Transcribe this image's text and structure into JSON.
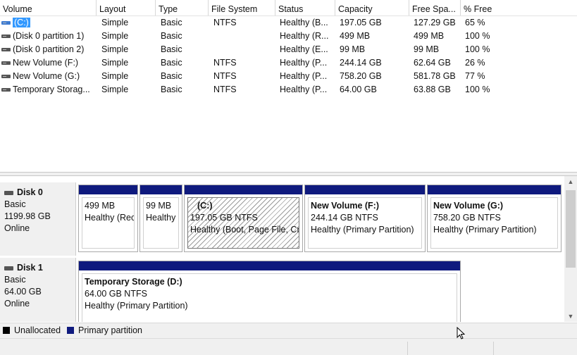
{
  "volume_table": {
    "columns": [
      "Volume",
      "Layout",
      "Type",
      "File System",
      "Status",
      "Capacity",
      "Free Spa...",
      "% Free"
    ],
    "rows": [
      {
        "volume": "(C:)",
        "layout": "Simple",
        "type": "Basic",
        "fs": "NTFS",
        "status": "Healthy (B...",
        "capacity": "197.05 GB",
        "free": "127.29 GB",
        "pct": "65 %"
      },
      {
        "volume": "(Disk 0 partition 1)",
        "layout": "Simple",
        "type": "Basic",
        "fs": "",
        "status": "Healthy (R...",
        "capacity": "499 MB",
        "free": "499 MB",
        "pct": "100 %"
      },
      {
        "volume": "(Disk 0 partition 2)",
        "layout": "Simple",
        "type": "Basic",
        "fs": "",
        "status": "Healthy (E...",
        "capacity": "99 MB",
        "free": "99 MB",
        "pct": "100 %"
      },
      {
        "volume": "New Volume (F:)",
        "layout": "Simple",
        "type": "Basic",
        "fs": "NTFS",
        "status": "Healthy (P...",
        "capacity": "244.14 GB",
        "free": "62.64 GB",
        "pct": "26 %"
      },
      {
        "volume": "New Volume (G:)",
        "layout": "Simple",
        "type": "Basic",
        "fs": "NTFS",
        "status": "Healthy (P...",
        "capacity": "758.20 GB",
        "free": "581.78 GB",
        "pct": "77 %"
      },
      {
        "volume": "Temporary Storag...",
        "layout": "Simple",
        "type": "Basic",
        "fs": "NTFS",
        "status": "Healthy (P...",
        "capacity": "64.00 GB",
        "free": "63.88 GB",
        "pct": "100 %"
      }
    ]
  },
  "disks": [
    {
      "name": "Disk 0",
      "type": "Basic",
      "size": "1199.98 GB",
      "state": "Online",
      "partitions": [
        {
          "title": "",
          "size": "499 MB",
          "status": "Healthy (Recovery Partition)"
        },
        {
          "title": "",
          "size": "99 MB",
          "status": "Healthy (EFI System Partition)"
        },
        {
          "title": "(C:)",
          "size": "197.05 GB NTFS",
          "status": "Healthy (Boot, Page File, Crash Dump, Primary Partition)"
        },
        {
          "title": "New Volume  (F:)",
          "size": "244.14 GB NTFS",
          "status": "Healthy (Primary Partition)"
        },
        {
          "title": "New Volume  (G:)",
          "size": "758.20 GB NTFS",
          "status": "Healthy (Primary Partition)"
        }
      ]
    },
    {
      "name": "Disk 1",
      "type": "Basic",
      "size": "64.00 GB",
      "state": "Online",
      "partitions": [
        {
          "title": "Temporary Storage  (D:)",
          "size": "64.00 GB NTFS",
          "status": "Healthy (Primary Partition)"
        }
      ]
    }
  ],
  "legend": [
    {
      "label": "Unallocated",
      "color": "#000000"
    },
    {
      "label": "Primary partition",
      "color": "#0f1a7e"
    }
  ],
  "colors": {
    "partition_bar": "#0f1a7e",
    "selection": "#3399ff"
  },
  "icons": {
    "volume": "drive-icon",
    "disk": "disk-icon",
    "scroll_up": "arrow-up-icon",
    "scroll_down": "arrow-down-icon"
  }
}
